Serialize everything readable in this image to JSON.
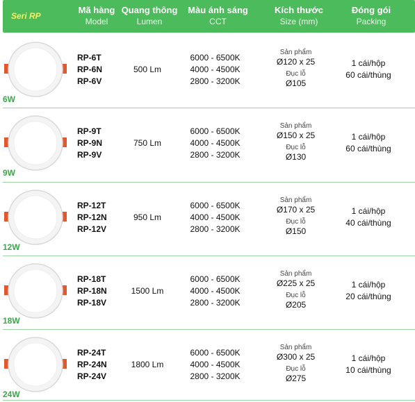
{
  "header": {
    "series": "Seri RP",
    "model_vi": "Mã hàng",
    "model_en": "Model",
    "lumen_vi": "Quang thông",
    "lumen_en": "Lumen",
    "cct_vi": "Màu ánh sáng",
    "cct_en": "CCT",
    "size_vi": "Kích thước",
    "size_en": "Size (mm)",
    "pack_vi": "Đóng gói",
    "pack_en": "Packing"
  },
  "rows": [
    {
      "watt": "6W",
      "models": [
        "RP-6T",
        "RP-6N",
        "RP-6V"
      ],
      "lumen": "500 Lm",
      "cct": [
        "6000 - 6500K",
        "4000 - 4500K",
        "2800 - 3200K"
      ],
      "product_label": "Sản phẩm",
      "product_size": "Ø120 x 25",
      "cut_label": "Đục lỗ",
      "cut_size": "Ø105",
      "pack": [
        "1 cái/hộp",
        "60 cái/thùng"
      ]
    },
    {
      "watt": "9W",
      "models": [
        "RP-9T",
        "RP-9N",
        "RP-9V"
      ],
      "lumen": "750 Lm",
      "cct": [
        "6000 - 6500K",
        "4000 - 4500K",
        "2800 - 3200K"
      ],
      "product_label": "Sản phẩm",
      "product_size": "Ø150 x 25",
      "cut_label": "Đục lỗ",
      "cut_size": "Ø130",
      "pack": [
        "1 cái/hộp",
        "60 cái/thùng"
      ]
    },
    {
      "watt": "12W",
      "models": [
        "RP-12T",
        "RP-12N",
        "RP-12V"
      ],
      "lumen": "950 Lm",
      "cct": [
        "6000 - 6500K",
        "4000 - 4500K",
        "2800 - 3200K"
      ],
      "product_label": "Sản phẩm",
      "product_size": "Ø170 x 25",
      "cut_label": "Đục lỗ",
      "cut_size": "Ø150",
      "pack": [
        "1 cái/hộp",
        "40 cái/thùng"
      ]
    },
    {
      "watt": "18W",
      "models": [
        "RP-18T",
        "RP-18N",
        "RP-18V"
      ],
      "lumen": "1500 Lm",
      "cct": [
        "6000 - 6500K",
        "4000 - 4500K",
        "2800 - 3200K"
      ],
      "product_label": "Sản phẩm",
      "product_size": "Ø225 x 25",
      "cut_label": "Đục lỗ",
      "cut_size": "Ø205",
      "pack": [
        "1 cái/hộp",
        "20 cái/thùng"
      ]
    },
    {
      "watt": "24W",
      "models": [
        "RP-24T",
        "RP-24N",
        "RP-24V"
      ],
      "lumen": "1800 Lm",
      "cct": [
        "6000 - 6500K",
        "4000 - 4500K",
        "2800 - 3200K"
      ],
      "product_label": "Sản phẩm",
      "product_size": "Ø300 x 25",
      "cut_label": "Đục lỗ",
      "cut_size": "Ø275",
      "pack": [
        "1 cái/hộp",
        "10 cái/thùng"
      ]
    }
  ],
  "colors": {
    "header_bg": "#4cbb5b",
    "series_text": "#ffef5a",
    "watt_text": "#3aa84a",
    "clip_orange": "#e2572b"
  },
  "icons": {
    "product": "round-led-panel-light-icon"
  }
}
